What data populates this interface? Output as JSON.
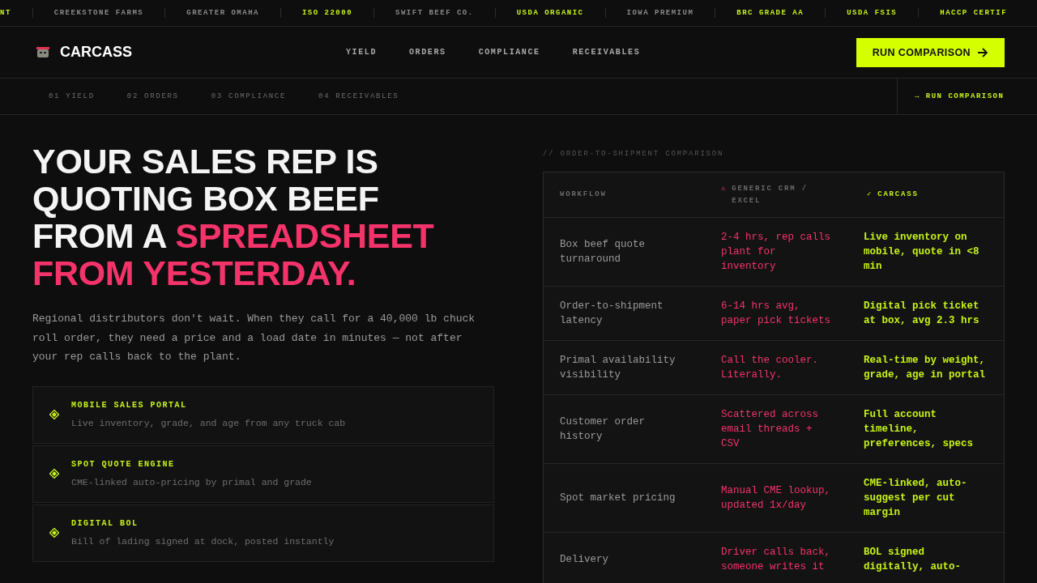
{
  "ticker": [
    {
      "text": "NT",
      "highlight": true
    },
    {
      "text": "CREEKSTONE FARMS",
      "highlight": false
    },
    {
      "text": "GREATER OMAHA",
      "highlight": false
    },
    {
      "text": "ISO 22000",
      "highlight": true
    },
    {
      "text": "SWIFT BEEF CO.",
      "highlight": false
    },
    {
      "text": "USDA ORGANIC",
      "highlight": true
    },
    {
      "text": "IOWA PREMIUM",
      "highlight": false
    },
    {
      "text": "BRC GRADE AA",
      "highlight": true
    },
    {
      "text": "USDA FSIS",
      "highlight": true
    },
    {
      "text": "HACCP CERTIF",
      "highlight": true
    }
  ],
  "nav": {
    "brand": "CARCASS",
    "links": [
      "YIELD",
      "ORDERS",
      "COMPLIANCE",
      "RECEIVABLES"
    ],
    "cta": "RUN COMPARISON"
  },
  "subnav": {
    "links": [
      "01 YIELD",
      "02 ORDERS",
      "03 COMPLIANCE",
      "04 RECEIVABLES"
    ],
    "cta": "→ RUN COMPARISON"
  },
  "hero": {
    "headline": [
      {
        "text": "YOUR SALES REP IS QUOTING BOX BEEF FROM A ",
        "accent": false
      },
      {
        "text": "SPREADSHEET FROM YESTERDAY.",
        "accent": true
      }
    ],
    "body": "Regional distributors don't wait. When they call for a 40,000 lb chuck roll order, they need a price and a load date in minutes — not after your rep calls back to the plant.",
    "features": [
      {
        "title": "MOBILE SALES PORTAL",
        "text": "Live inventory, grade, and age from any truck cab"
      },
      {
        "title": "SPOT QUOTE ENGINE",
        "text": "CME-linked auto-pricing by primal and grade"
      },
      {
        "title": "DIGITAL BOL",
        "text": "Bill of lading signed at dock, posted instantly"
      }
    ]
  },
  "comparison": {
    "label": "// ORDER-TO-SHIPMENT COMPARISON",
    "columns": [
      {
        "kind": "plain",
        "label": "WORKFLOW"
      },
      {
        "kind": "bad",
        "mark": "⚠",
        "label": "GENERIC CRM / EXCEL"
      },
      {
        "kind": "good",
        "mark": "✓",
        "label": "CARCASS"
      }
    ],
    "rows": [
      [
        "Box beef quote turnaround",
        "2-4 hrs, rep calls plant for inventory",
        "Live inventory on mobile, quote in <8 min"
      ],
      [
        "Order-to-shipment latency",
        "6-14 hrs avg, paper pick tickets",
        "Digital pick ticket at box, avg 2.3 hrs"
      ],
      [
        "Primal availability visibility",
        "Call the cooler. Literally.",
        "Real-time by weight, grade, age in portal"
      ],
      [
        "Customer order history",
        "Scattered across email threads + CSV",
        "Full account timeline, preferences, specs"
      ],
      [
        "Spot market pricing",
        "Manual CME lookup, updated 1x/day",
        "CME-linked, auto-suggest per cut margin"
      ],
      [
        "Delivery",
        "Driver calls back, someone writes it",
        "BOL signed digitally, auto-"
      ]
    ]
  }
}
